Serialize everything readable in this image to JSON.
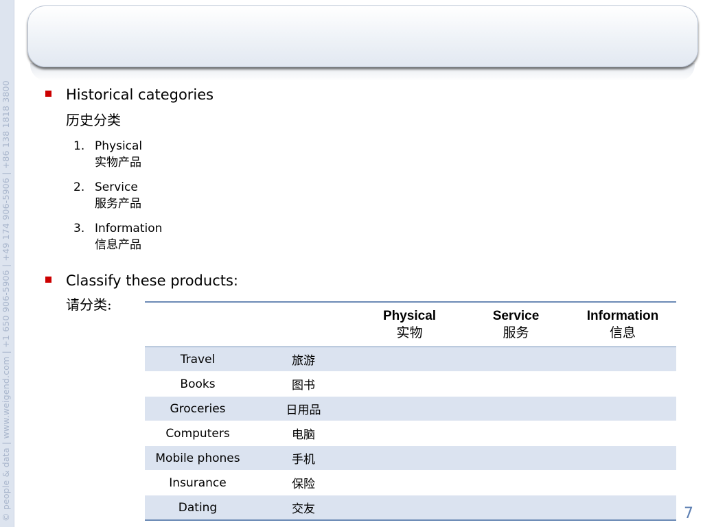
{
  "sidebar": {
    "vertical_text": "© people & data | www.weigend.com | +1 650 906-5906 | +49 174 906-5906 | +86 138 1818 3800"
  },
  "section1": {
    "title": "Historical categories",
    "subtitle": "历史分类",
    "items": [
      {
        "number": "1.",
        "en": "Physical",
        "zh": "实物产品"
      },
      {
        "number": "2.",
        "en": "Service",
        "zh": "服务产品"
      },
      {
        "number": "3.",
        "en": "Information",
        "zh": "信息产品"
      }
    ]
  },
  "section2": {
    "title": "Classify these products:",
    "subtitle": "请分类:"
  },
  "table": {
    "headers": [
      {
        "en": "",
        "zh": ""
      },
      {
        "en": "",
        "zh": ""
      },
      {
        "en": "Physical",
        "zh": "实物"
      },
      {
        "en": "Service",
        "zh": "服务"
      },
      {
        "en": "Information",
        "zh": "信息"
      }
    ],
    "rows": [
      {
        "en": "Travel",
        "zh": "旅游"
      },
      {
        "en": "Books",
        "zh": "图书"
      },
      {
        "en": "Groceries",
        "zh": "日用品"
      },
      {
        "en": "Computers",
        "zh": "电脑"
      },
      {
        "en": "Mobile phones",
        "zh": "手机"
      },
      {
        "en": "Insurance",
        "zh": "保险"
      },
      {
        "en": "Dating",
        "zh": "交友"
      }
    ]
  },
  "footer": {
    "page_number": "7"
  },
  "colors": {
    "bullet": "#cc0000",
    "table_stripe": "#dbe3f0",
    "table_rule": "#6b8ab5",
    "page_number": "#5d7fb2"
  }
}
